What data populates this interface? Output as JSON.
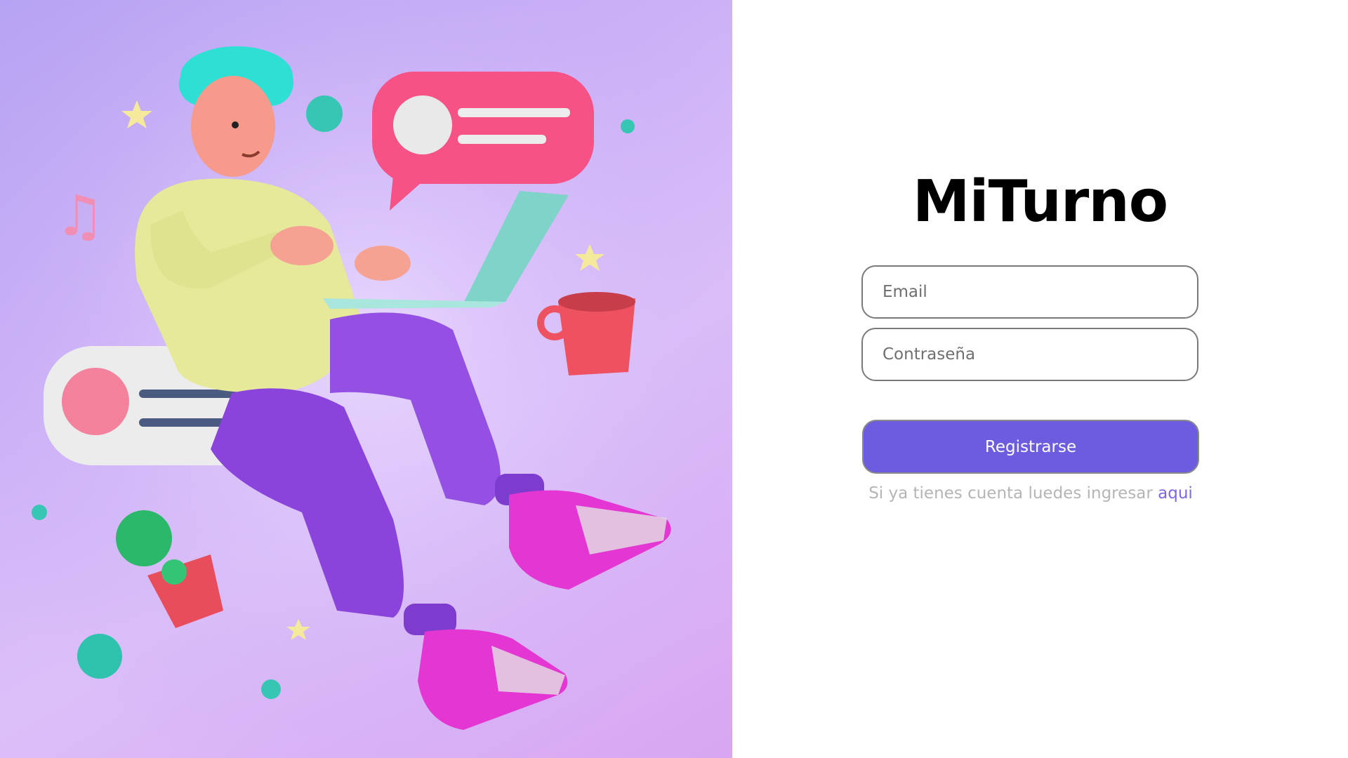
{
  "brand": {
    "title": "MiTurno"
  },
  "form": {
    "email_placeholder": "Email",
    "password_placeholder": "Contraseña",
    "submit_label": "Registrarse",
    "login_prompt": "Si ya tienes cuenta luedes ingresar",
    "login_link": "aqui"
  },
  "colors": {
    "accent": "#6c5ce0",
    "link": "#7b68e6",
    "hint_text": "#b5b5b5"
  }
}
